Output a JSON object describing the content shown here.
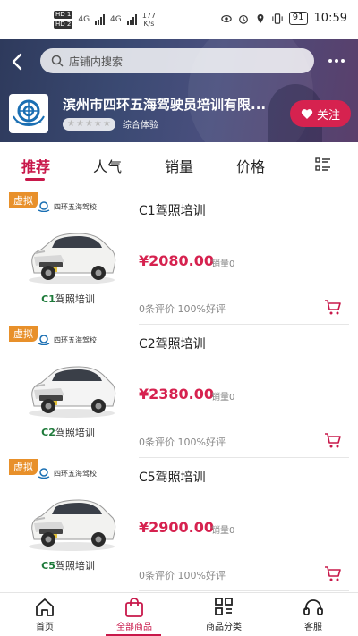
{
  "status_bar": {
    "sim1": "HD 1",
    "sim2": "HD 2",
    "net1": "4G",
    "net2": "4G",
    "speed_value": "177",
    "speed_unit": "K/s",
    "battery": "91",
    "time": "10:59"
  },
  "header": {
    "search_placeholder": "店铺内搜索",
    "shop_name": "滨州市四环五海驾驶员培训有限...",
    "rating_label": "综合体验",
    "rating_stars": 5,
    "follow_label": "关注"
  },
  "tabs": [
    {
      "label": "推荐",
      "active": true
    },
    {
      "label": "人气",
      "active": false
    },
    {
      "label": "销量",
      "active": false
    },
    {
      "label": "价格",
      "active": false
    }
  ],
  "products": [
    {
      "badge": "虚拟",
      "school": "四环五海驾校",
      "caption_code": "C1",
      "caption_text": "驾照培训",
      "title": "C1驾照培训",
      "price": "¥2080.00",
      "sales": "销量0",
      "reviews": "0条评价  100%好评",
      "car_color": "#f2f2f0"
    },
    {
      "badge": "虚拟",
      "school": "四环五海驾校",
      "caption_code": "C2",
      "caption_text": "驾照培训",
      "title": "C2驾照培训",
      "price": "¥2380.00",
      "sales": "销量0",
      "reviews": "0条评价  100%好评",
      "car_color": "#f4f4f4"
    },
    {
      "badge": "虚拟",
      "school": "四环五海驾校",
      "caption_code": "C5",
      "caption_text": "驾照培训",
      "title": "C5驾照培训",
      "price": "¥2900.00",
      "sales": "销量0",
      "reviews": "0条评价  100%好评",
      "car_color": "#f2f2f0"
    }
  ],
  "bottom_nav": [
    {
      "label": "首页",
      "icon": "home-icon",
      "active": false
    },
    {
      "label": "全部商品",
      "icon": "bag-icon",
      "active": true
    },
    {
      "label": "商品分类",
      "icon": "grid-icon",
      "active": false
    },
    {
      "label": "客服",
      "icon": "headset-icon",
      "active": false
    }
  ],
  "colors": {
    "accent": "#c8184a",
    "price": "#d6224f",
    "badge": "#e8902a"
  }
}
